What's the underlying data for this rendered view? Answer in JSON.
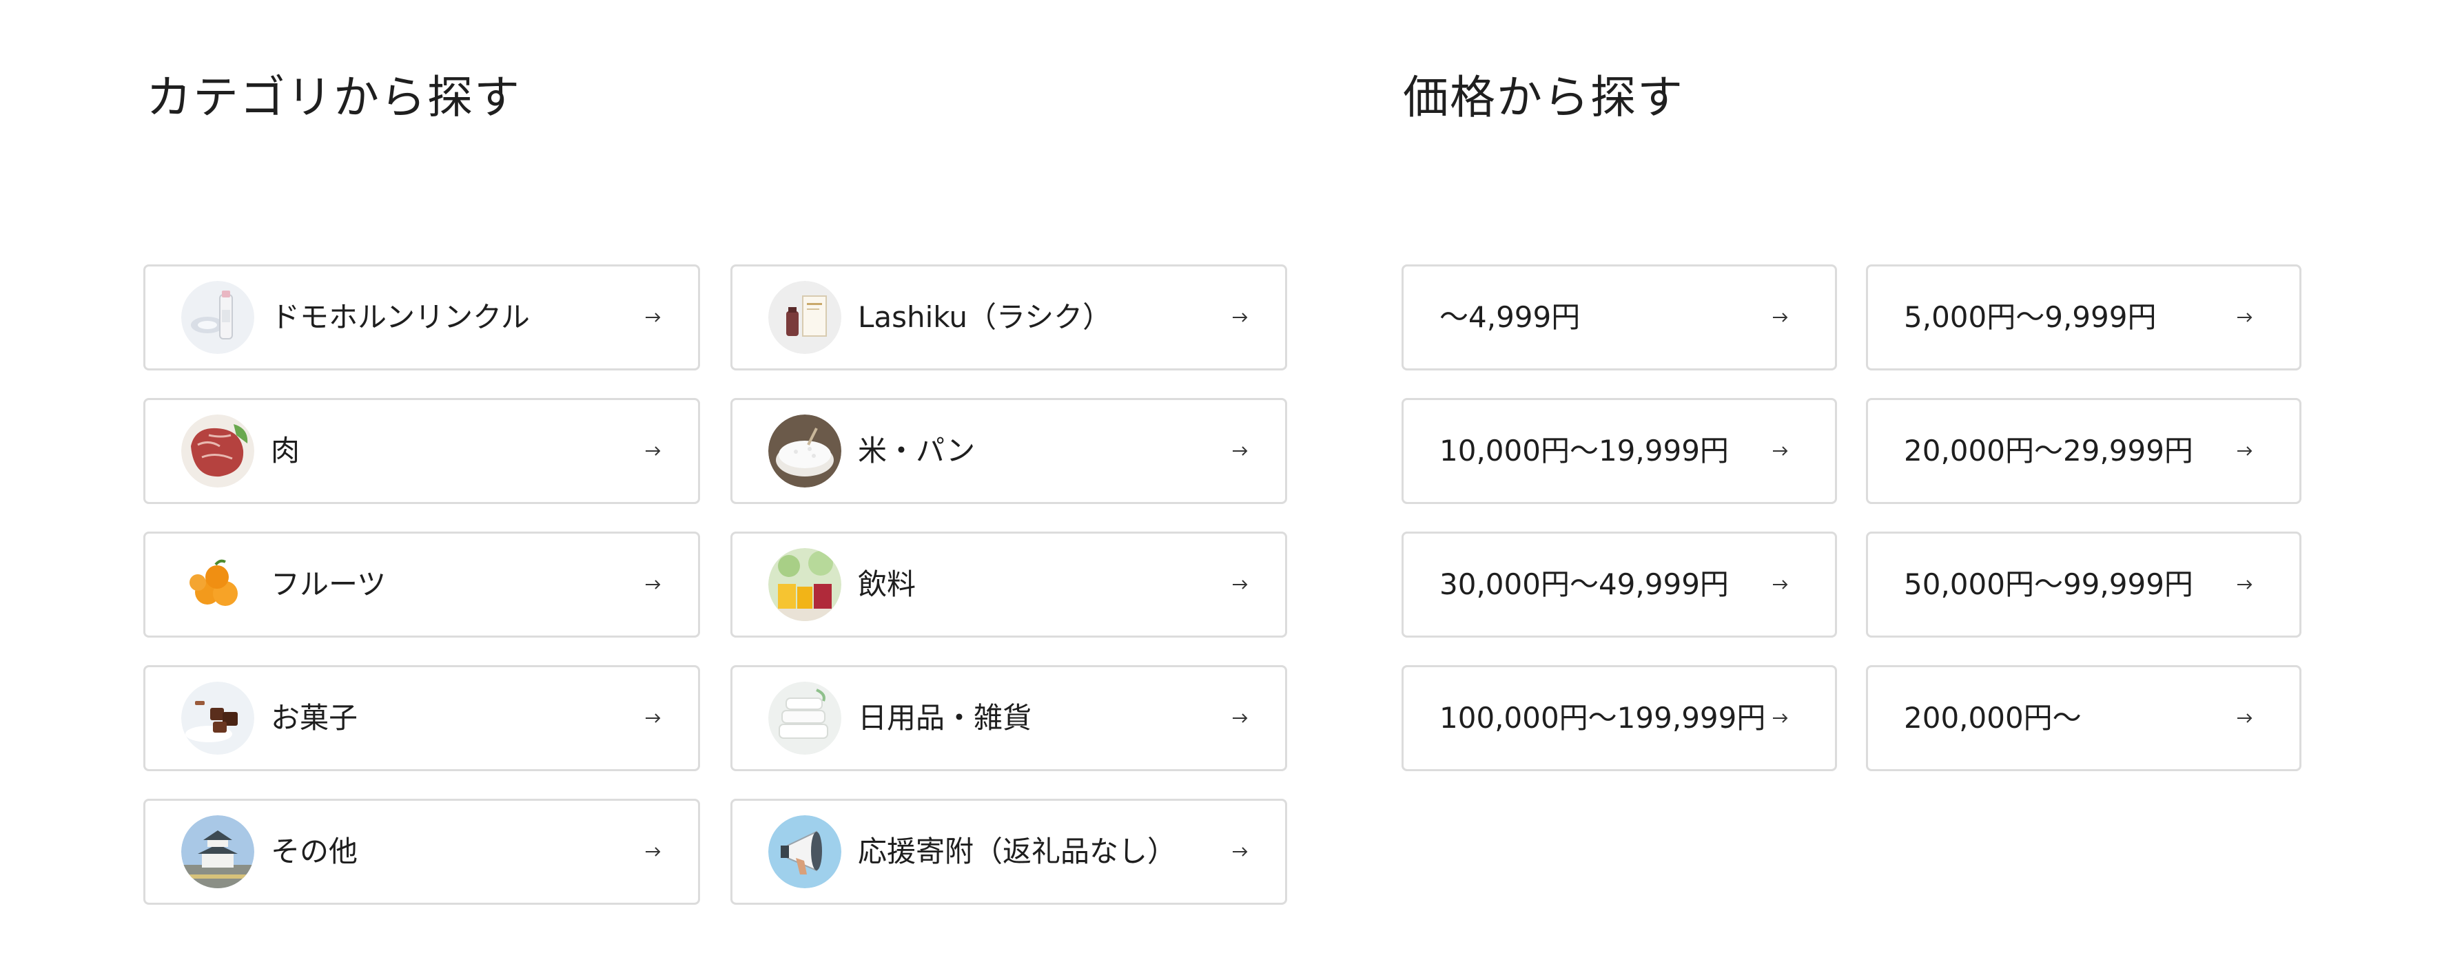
{
  "category_section": {
    "title": "カテゴリから探す",
    "items": [
      {
        "label": "ドモホルンリンクル",
        "icon": "skincare-bottle-thumb"
      },
      {
        "label": "Lashiku（ラシク）",
        "icon": "supplement-box-thumb"
      },
      {
        "label": "肉",
        "icon": "beef-thumb"
      },
      {
        "label": "米・パン",
        "icon": "rice-bowl-thumb"
      },
      {
        "label": "フルーツ",
        "icon": "oranges-thumb"
      },
      {
        "label": "飲料",
        "icon": "juice-glasses-thumb"
      },
      {
        "label": "お菓子",
        "icon": "chocolate-thumb"
      },
      {
        "label": "日用品・雑貨",
        "icon": "towels-thumb"
      },
      {
        "label": "その他",
        "icon": "castle-thumb"
      },
      {
        "label": "応援寄附（返礼品なし）",
        "icon": "megaphone-thumb"
      }
    ]
  },
  "price_section": {
    "title": "価格から探す",
    "items": [
      {
        "label": "〜4,999円"
      },
      {
        "label": "5,000円〜9,999円"
      },
      {
        "label": "10,000円〜19,999円"
      },
      {
        "label": "20,000円〜29,999円"
      },
      {
        "label": "30,000円〜49,999円"
      },
      {
        "label": "50,000円〜99,999円"
      },
      {
        "label": "100,000円〜199,999円"
      },
      {
        "label": "200,000円〜"
      }
    ]
  },
  "colors": {
    "card_border": "#dcdcdc",
    "text": "#1e1e1e",
    "arrow": "#333333"
  }
}
